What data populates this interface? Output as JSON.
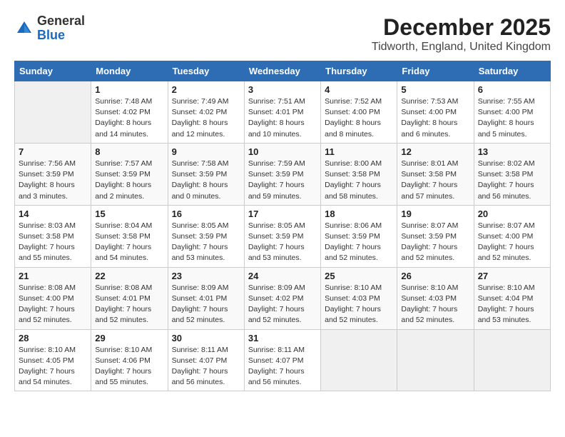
{
  "logo": {
    "general": "General",
    "blue": "Blue"
  },
  "header": {
    "month": "December 2025",
    "location": "Tidworth, England, United Kingdom"
  },
  "weekdays": [
    "Sunday",
    "Monday",
    "Tuesday",
    "Wednesday",
    "Thursday",
    "Friday",
    "Saturday"
  ],
  "weeks": [
    [
      {
        "day": "",
        "sunrise": "",
        "sunset": "",
        "daylight": ""
      },
      {
        "day": "1",
        "sunrise": "Sunrise: 7:48 AM",
        "sunset": "Sunset: 4:02 PM",
        "daylight": "Daylight: 8 hours and 14 minutes."
      },
      {
        "day": "2",
        "sunrise": "Sunrise: 7:49 AM",
        "sunset": "Sunset: 4:02 PM",
        "daylight": "Daylight: 8 hours and 12 minutes."
      },
      {
        "day": "3",
        "sunrise": "Sunrise: 7:51 AM",
        "sunset": "Sunset: 4:01 PM",
        "daylight": "Daylight: 8 hours and 10 minutes."
      },
      {
        "day": "4",
        "sunrise": "Sunrise: 7:52 AM",
        "sunset": "Sunset: 4:00 PM",
        "daylight": "Daylight: 8 hours and 8 minutes."
      },
      {
        "day": "5",
        "sunrise": "Sunrise: 7:53 AM",
        "sunset": "Sunset: 4:00 PM",
        "daylight": "Daylight: 8 hours and 6 minutes."
      },
      {
        "day": "6",
        "sunrise": "Sunrise: 7:55 AM",
        "sunset": "Sunset: 4:00 PM",
        "daylight": "Daylight: 8 hours and 5 minutes."
      }
    ],
    [
      {
        "day": "7",
        "sunrise": "Sunrise: 7:56 AM",
        "sunset": "Sunset: 3:59 PM",
        "daylight": "Daylight: 8 hours and 3 minutes."
      },
      {
        "day": "8",
        "sunrise": "Sunrise: 7:57 AM",
        "sunset": "Sunset: 3:59 PM",
        "daylight": "Daylight: 8 hours and 2 minutes."
      },
      {
        "day": "9",
        "sunrise": "Sunrise: 7:58 AM",
        "sunset": "Sunset: 3:59 PM",
        "daylight": "Daylight: 8 hours and 0 minutes."
      },
      {
        "day": "10",
        "sunrise": "Sunrise: 7:59 AM",
        "sunset": "Sunset: 3:59 PM",
        "daylight": "Daylight: 7 hours and 59 minutes."
      },
      {
        "day": "11",
        "sunrise": "Sunrise: 8:00 AM",
        "sunset": "Sunset: 3:58 PM",
        "daylight": "Daylight: 7 hours and 58 minutes."
      },
      {
        "day": "12",
        "sunrise": "Sunrise: 8:01 AM",
        "sunset": "Sunset: 3:58 PM",
        "daylight": "Daylight: 7 hours and 57 minutes."
      },
      {
        "day": "13",
        "sunrise": "Sunrise: 8:02 AM",
        "sunset": "Sunset: 3:58 PM",
        "daylight": "Daylight: 7 hours and 56 minutes."
      }
    ],
    [
      {
        "day": "14",
        "sunrise": "Sunrise: 8:03 AM",
        "sunset": "Sunset: 3:58 PM",
        "daylight": "Daylight: 7 hours and 55 minutes."
      },
      {
        "day": "15",
        "sunrise": "Sunrise: 8:04 AM",
        "sunset": "Sunset: 3:58 PM",
        "daylight": "Daylight: 7 hours and 54 minutes."
      },
      {
        "day": "16",
        "sunrise": "Sunrise: 8:05 AM",
        "sunset": "Sunset: 3:59 PM",
        "daylight": "Daylight: 7 hours and 53 minutes."
      },
      {
        "day": "17",
        "sunrise": "Sunrise: 8:05 AM",
        "sunset": "Sunset: 3:59 PM",
        "daylight": "Daylight: 7 hours and 53 minutes."
      },
      {
        "day": "18",
        "sunrise": "Sunrise: 8:06 AM",
        "sunset": "Sunset: 3:59 PM",
        "daylight": "Daylight: 7 hours and 52 minutes."
      },
      {
        "day": "19",
        "sunrise": "Sunrise: 8:07 AM",
        "sunset": "Sunset: 3:59 PM",
        "daylight": "Daylight: 7 hours and 52 minutes."
      },
      {
        "day": "20",
        "sunrise": "Sunrise: 8:07 AM",
        "sunset": "Sunset: 4:00 PM",
        "daylight": "Daylight: 7 hours and 52 minutes."
      }
    ],
    [
      {
        "day": "21",
        "sunrise": "Sunrise: 8:08 AM",
        "sunset": "Sunset: 4:00 PM",
        "daylight": "Daylight: 7 hours and 52 minutes."
      },
      {
        "day": "22",
        "sunrise": "Sunrise: 8:08 AM",
        "sunset": "Sunset: 4:01 PM",
        "daylight": "Daylight: 7 hours and 52 minutes."
      },
      {
        "day": "23",
        "sunrise": "Sunrise: 8:09 AM",
        "sunset": "Sunset: 4:01 PM",
        "daylight": "Daylight: 7 hours and 52 minutes."
      },
      {
        "day": "24",
        "sunrise": "Sunrise: 8:09 AM",
        "sunset": "Sunset: 4:02 PM",
        "daylight": "Daylight: 7 hours and 52 minutes."
      },
      {
        "day": "25",
        "sunrise": "Sunrise: 8:10 AM",
        "sunset": "Sunset: 4:03 PM",
        "daylight": "Daylight: 7 hours and 52 minutes."
      },
      {
        "day": "26",
        "sunrise": "Sunrise: 8:10 AM",
        "sunset": "Sunset: 4:03 PM",
        "daylight": "Daylight: 7 hours and 52 minutes."
      },
      {
        "day": "27",
        "sunrise": "Sunrise: 8:10 AM",
        "sunset": "Sunset: 4:04 PM",
        "daylight": "Daylight: 7 hours and 53 minutes."
      }
    ],
    [
      {
        "day": "28",
        "sunrise": "Sunrise: 8:10 AM",
        "sunset": "Sunset: 4:05 PM",
        "daylight": "Daylight: 7 hours and 54 minutes."
      },
      {
        "day": "29",
        "sunrise": "Sunrise: 8:10 AM",
        "sunset": "Sunset: 4:06 PM",
        "daylight": "Daylight: 7 hours and 55 minutes."
      },
      {
        "day": "30",
        "sunrise": "Sunrise: 8:11 AM",
        "sunset": "Sunset: 4:07 PM",
        "daylight": "Daylight: 7 hours and 56 minutes."
      },
      {
        "day": "31",
        "sunrise": "Sunrise: 8:11 AM",
        "sunset": "Sunset: 4:07 PM",
        "daylight": "Daylight: 7 hours and 56 minutes."
      },
      {
        "day": "",
        "sunrise": "",
        "sunset": "",
        "daylight": ""
      },
      {
        "day": "",
        "sunrise": "",
        "sunset": "",
        "daylight": ""
      },
      {
        "day": "",
        "sunrise": "",
        "sunset": "",
        "daylight": ""
      }
    ]
  ]
}
